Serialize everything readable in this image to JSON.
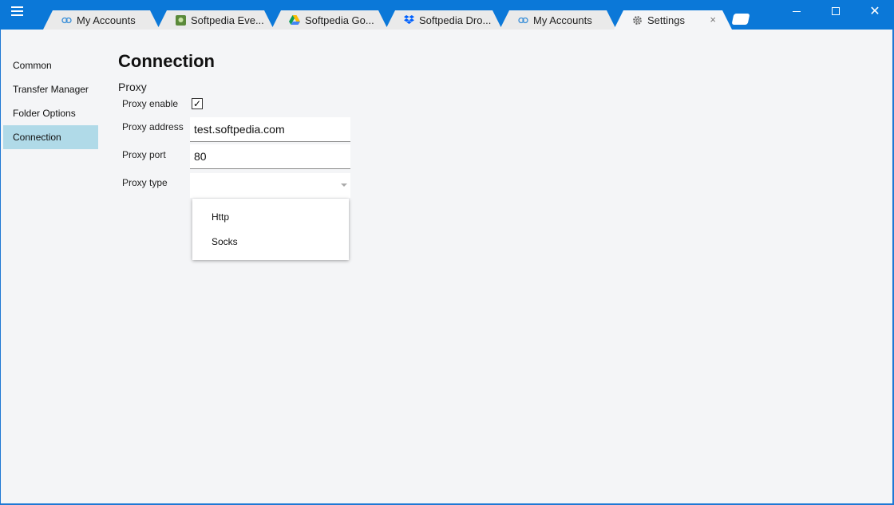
{
  "tabs": [
    {
      "label": "My Accounts",
      "icon": "link-icon"
    },
    {
      "label": "Softpedia Eve...",
      "icon": "evernote-icon"
    },
    {
      "label": "Softpedia Go...",
      "icon": "google-drive-icon"
    },
    {
      "label": "Softpedia Dro...",
      "icon": "dropbox-icon"
    },
    {
      "label": "My Accounts",
      "icon": "link-icon"
    },
    {
      "label": "Settings",
      "icon": "gear-icon",
      "active": true,
      "close": "×"
    }
  ],
  "window": {
    "close": "✕"
  },
  "sidebar": {
    "items": [
      {
        "label": "Common"
      },
      {
        "label": "Transfer Manager"
      },
      {
        "label": "Folder Options"
      },
      {
        "label": "Connection",
        "active": true
      }
    ]
  },
  "page": {
    "title": "Connection",
    "section": "Proxy"
  },
  "form": {
    "proxy_enable_label": "Proxy enable",
    "proxy_enable_checked": true,
    "proxy_enable_mark": "✓",
    "proxy_address_label": "Proxy address",
    "proxy_address_value": "test.softpedia.com",
    "proxy_port_label": "Proxy port",
    "proxy_port_value": "80",
    "proxy_type_label": "Proxy type",
    "proxy_type_value": "",
    "proxy_type_options": [
      "Http",
      "Socks"
    ]
  },
  "colors": {
    "titlebar": "#0b78d8",
    "content_bg": "#f4f5f7",
    "nav_active": "#b0dae8"
  }
}
